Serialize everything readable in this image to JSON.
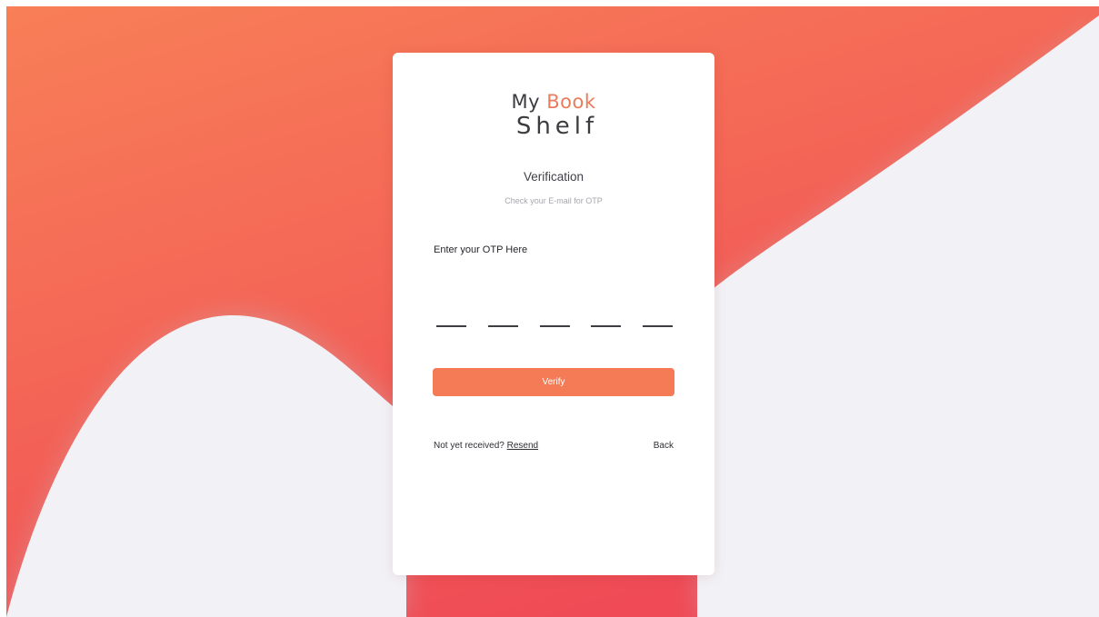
{
  "brand": {
    "name_part1": "My",
    "name_accent": "Book",
    "name_part2": "Shelf"
  },
  "header": {
    "title": "Verification",
    "subtitle": "Check your E-mail for OTP"
  },
  "otp": {
    "label": "Enter your OTP Here",
    "slots": [
      "",
      "",
      "",
      "",
      ""
    ]
  },
  "actions": {
    "verify_label": "Verify",
    "resend_prompt": "Not yet received?",
    "resend_label": "Resend",
    "back_label": "Back"
  },
  "colors": {
    "accent": "#f47b56",
    "brand_accent": "#ea7c5c",
    "background_gradient_start": "#f87f57",
    "background_gradient_end": "#ef4a56",
    "page_background": "#f2f2f6"
  }
}
